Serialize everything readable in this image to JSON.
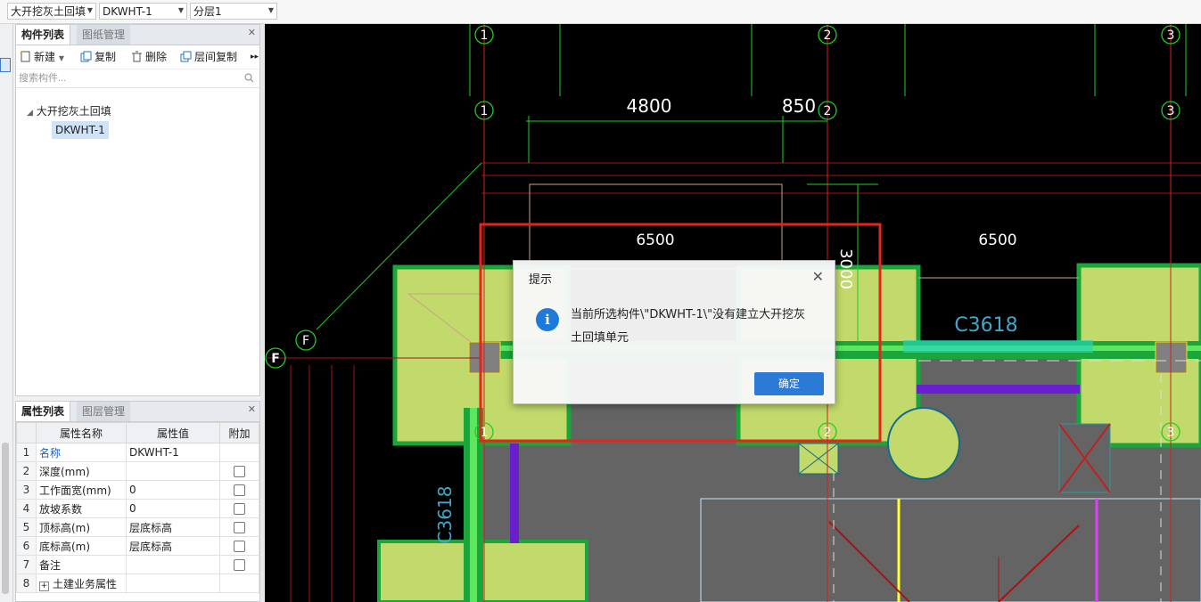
{
  "topbar": {
    "dropdown1": "大开挖灰土回填",
    "dropdown2": "DKWHT-1",
    "dropdown3": "分层1"
  },
  "component_panel": {
    "tab_active": "构件列表",
    "tab_inactive": "图纸管理",
    "toolbar": {
      "new": "新建",
      "copy": "复制",
      "delete": "删除",
      "floor_copy": "层间复制"
    },
    "search_placeholder": "搜索构件...",
    "tree_root": "大开挖灰土回填",
    "tree_child": "DKWHT-1"
  },
  "property_panel": {
    "tab_active": "属性列表",
    "tab_inactive": "图层管理",
    "headers": [
      "属性名称",
      "属性值",
      "附加"
    ],
    "rows": [
      {
        "idx": "1",
        "name": "名称",
        "value": "DKWHT-1"
      },
      {
        "idx": "2",
        "name": "深度(mm)",
        "value": ""
      },
      {
        "idx": "3",
        "name": "工作面宽(mm)",
        "value": "0"
      },
      {
        "idx": "4",
        "name": "放坡系数",
        "value": "0"
      },
      {
        "idx": "5",
        "name": "顶标高(m)",
        "value": "层底标高"
      },
      {
        "idx": "6",
        "name": "底标高(m)",
        "value": "层底标高"
      },
      {
        "idx": "7",
        "name": "备注",
        "value": ""
      },
      {
        "idx": "8",
        "name": "土建业务属性",
        "value": ""
      }
    ]
  },
  "drawing": {
    "axis_labels": [
      "1",
      "2",
      "3",
      "F"
    ],
    "dims": [
      "4800",
      "850",
      "6500",
      "6500",
      "3000"
    ],
    "window_labels": [
      "C3618",
      "C3618"
    ]
  },
  "dialog": {
    "title": "提示",
    "message": "当前所选构件\\\"DKWHT-1\\\"没有建立大开挖灰土回填单元",
    "ok": "确定"
  },
  "colors": {
    "accent": "#2b7ad6",
    "highlight_frame": "#e8231b",
    "fill": "#c2d96b",
    "wall": "#1aa63a"
  }
}
